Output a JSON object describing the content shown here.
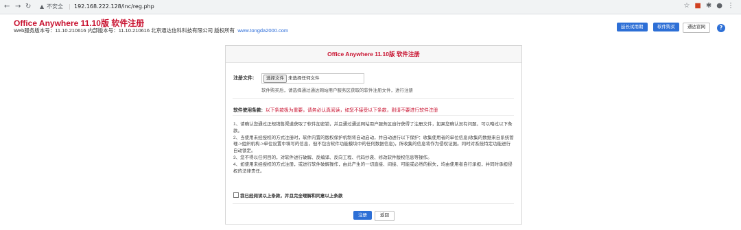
{
  "browser": {
    "security": "不安全",
    "url": "192.168.222.128/inc/reg.php"
  },
  "header": {
    "title": "Office Anywhere 11.10版 软件注册",
    "subtitle": "Web服务版本号：11.10.210616  内部版本号：11.10.210616  北京通达信科科技有限公司 版权所有",
    "site_link": "www.tongda2000.com",
    "btn_extend": "延长试用期",
    "btn_buy": "软件购买",
    "btn_site": "通达官网",
    "help": "?"
  },
  "panel": {
    "title": "Office Anywhere 11.10版 软件注册",
    "reg_file_label": "注册文件:",
    "choose_file": "选择文件",
    "no_file": "未选择任何文件",
    "hint": "软件购买后，请选择通过通达网站用户服务区获取的软件注册文件，进行注册",
    "terms_label": "软件使用条款:",
    "terms_warning": "以下条款极为重要，请务必认真阅读，如您不接受以下条款，则请不要进行软件注册",
    "terms": [
      "1、请确认您通过正规销售渠道获取了软件加密锁，并且通过通达网站用户服务区自行获得了注册文件，如果您确认没有问题，可以略过以下条款。",
      "2、当使用未经授权的方式注册时，软件内置的版权保护机制将自动启动，并自动进行以下保护：收集使用者的单位信息(收集的数据来自系统管理->组织机构->单位设置中填写的信息，但不包含软件功能模块中的任何数据信息)，所收集的信息将作为侵权证据。同时对系统特定功能进行自动锁定。",
      "3、您不得以任何目的，对软件进行破解、反编译、反向工程、代码抄袭、修改软件版权信息等操作。",
      "4、如使用未经授权的方式注册，或进行软件破解操作，由此产生的一切直接、间接、可能或必然的损失，均由使用者自行承担，并同时承担侵权的法律责任。"
    ],
    "agree": "我已经阅读以上条款，并且完全理解和同意以上条款",
    "btn_register": "注册",
    "btn_back": "返回"
  }
}
